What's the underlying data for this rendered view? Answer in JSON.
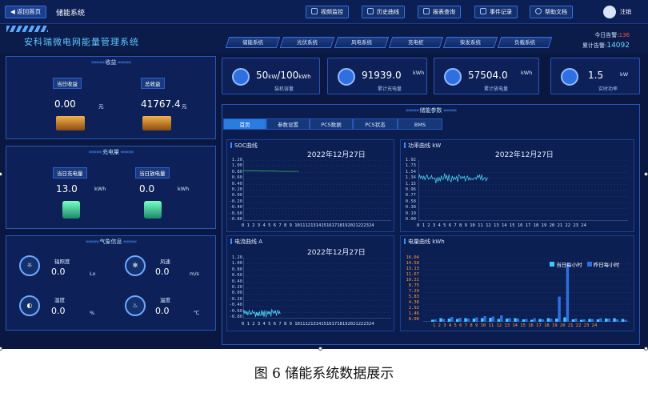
{
  "topbar": {
    "back_label": "返回首页",
    "system_name": "储能系统",
    "buttons": [
      {
        "label": "视频监控",
        "icon": "video-icon"
      },
      {
        "label": "历史曲线",
        "icon": "history-icon"
      },
      {
        "label": "报表查询",
        "icon": "search-icon"
      },
      {
        "label": "事件记录",
        "icon": "document-icon"
      },
      {
        "label": "帮助文档",
        "icon": "help-icon"
      }
    ],
    "logout": "注销"
  },
  "header": {
    "app_title": "安科瑞微电网能量管理系统",
    "tabs": [
      "储能系统",
      "光伏系统",
      "风电系统",
      "充电桩",
      "柴发系统",
      "负载系统"
    ],
    "alarm_today_label": "今日告警:",
    "alarm_today": "136",
    "alarm_total_label": "累计告警:",
    "alarm_total": "14092"
  },
  "revenue": {
    "title": "收益",
    "today_label": "当日收益",
    "today_value": "0.00",
    "today_unit": "元",
    "total_label": "总收益",
    "total_value": "41767.4",
    "total_unit": "元"
  },
  "energy": {
    "title": "充电量",
    "charge_label": "当日充电量",
    "charge_value": "13.0",
    "charge_unit": "kWh",
    "discharge_label": "当日放电量",
    "discharge_value": "0.0",
    "discharge_unit": "kWh"
  },
  "weather": {
    "title": "气象信息",
    "items": [
      {
        "label": "辐照度",
        "value": "0.0",
        "unit": "Lx",
        "icon": "sun-icon"
      },
      {
        "label": "风速",
        "value": "0.0",
        "unit": "m/s",
        "icon": "fan-icon"
      },
      {
        "label": "湿度",
        "value": "0.0",
        "unit": "%",
        "icon": "humidity-icon"
      },
      {
        "label": "温度",
        "value": "0.0",
        "unit": "℃",
        "icon": "thermometer-icon"
      }
    ]
  },
  "cards": [
    {
      "value": "50",
      "unit1": "kW",
      "sep": "/",
      "value2": "100",
      "unit2": "kWh",
      "label": "装机容量",
      "icon": "battery-icon"
    },
    {
      "value": "91939.0",
      "unit": "kWh",
      "label": "累计充电量",
      "icon": "gauge-icon"
    },
    {
      "value": "57504.0",
      "unit": "kWh",
      "label": "累计放电量",
      "icon": "gauge-icon"
    },
    {
      "value": "1.5",
      "unit": "kW",
      "label": "实时功率",
      "icon": "pulse-icon"
    }
  ],
  "params": {
    "title": "储能参数",
    "subtabs": [
      "首页",
      "参数设置",
      "PCS数据",
      "PCS状态",
      "BMS"
    ],
    "active": 0
  },
  "charts": {
    "soc": {
      "title": "SOC曲线",
      "date": "2022年12月27日",
      "yticks": [
        "1.20",
        "1.00",
        "0.80",
        "0.60",
        "0.40",
        "0.20",
        "0.00",
        "-0.20",
        "-0.40",
        "-0.60",
        "-0.80"
      ],
      "xticks": "0 1 2 3 4 5 6 7 8 9 101112131415161718192021222324"
    },
    "power": {
      "title": "功率曲线 kW",
      "date": "2022年12月27日",
      "yticks": [
        "1.92",
        "1.73",
        "1.54",
        "1.34",
        "1.15",
        "0.96",
        "0.77",
        "0.58",
        "0.38",
        "0.19",
        "0.00"
      ],
      "xticks": "0  1  2  3  4  5  6  7  8  9 10 11 12 13 14 15 16 17 18 19 20 21 22 23 24"
    },
    "current": {
      "title": "电流曲线 A",
      "date": "2022年12月27日",
      "yticks": [
        "1.20",
        "1.00",
        "0.80",
        "0.60",
        "0.40",
        "0.20",
        "0.00",
        "-0.20",
        "-0.40",
        "-0.60",
        "-0.80"
      ],
      "xticks": "0 1 2 3 4 5 6 7 8 9 101112131415161718192021222324"
    },
    "electricity": {
      "title": "电量曲线 kWh",
      "yticks": [
        "16.04",
        "14.58",
        "13.13",
        "11.67",
        "10.21",
        "8.75",
        "7.29",
        "5.83",
        "4.38",
        "2.92",
        "1.46",
        "0.00"
      ],
      "xticks": "1  2  3  4  5  6  7  8  9 10 11 12 13 14 15 16 17 18 19 20 21 22 23 24",
      "legend": [
        "当日每小时",
        "昨日每小时"
      ],
      "colors": [
        "#40c8ff",
        "#2f6fe0"
      ]
    }
  },
  "chart_data": [
    {
      "type": "line",
      "title": "SOC曲线",
      "ylim": [
        -0.8,
        1.2
      ],
      "x": [
        0,
        1,
        2,
        3,
        4,
        5,
        6,
        7,
        8,
        9
      ],
      "series": [
        {
          "values": [
            0.85,
            0.85,
            0.85,
            0.84,
            0.84,
            0.84,
            0.83,
            0.83,
            0.83,
            0.83
          ]
        }
      ]
    },
    {
      "type": "line",
      "title": "功率曲线 kW",
      "ylim": [
        0,
        1.92
      ],
      "x": [
        0,
        1,
        2,
        3,
        4,
        5,
        6,
        7,
        8
      ],
      "series": [
        {
          "values": [
            1.34,
            1.38,
            1.3,
            1.4,
            1.33,
            1.36,
            1.31,
            1.39,
            1.35
          ]
        }
      ]
    },
    {
      "type": "line",
      "title": "电流曲线 A",
      "ylim": [
        -0.8,
        1.2
      ],
      "x": [
        0,
        1,
        2,
        3,
        4,
        5,
        6
      ],
      "series": [
        {
          "values": [
            -0.63,
            -0.61,
            -0.64,
            -0.62,
            -0.63,
            -0.6,
            -0.63
          ]
        }
      ]
    },
    {
      "type": "bar",
      "title": "电量曲线 kWh",
      "ylim": [
        0,
        16.04
      ],
      "categories": [
        "1",
        "2",
        "3",
        "4",
        "5",
        "6",
        "7",
        "8",
        "9",
        "10",
        "11",
        "12",
        "13",
        "14",
        "15",
        "16",
        "17",
        "18",
        "19",
        "20",
        "21",
        "22",
        "23",
        "24"
      ],
      "series": [
        {
          "name": "当日每小时",
          "values": [
            0.5,
            0.9,
            0.8,
            0.7,
            0.9,
            0.8,
            0.9,
            1.0,
            0.7,
            0.8,
            0.9,
            0.6,
            0.5,
            0.7,
            0.9,
            0.8,
            1.1,
            0.6,
            0.5,
            0.7,
            0.6,
            0.8,
            0.9,
            0.7
          ]
        },
        {
          "name": "昨日每小时",
          "values": [
            0.6,
            0.7,
            1.2,
            1.0,
            0.8,
            1.1,
            1.4,
            1.3,
            1.6,
            0.9,
            0.8,
            0.7,
            0.9,
            0.6,
            0.8,
            6.3,
            14.6,
            0.8,
            0.6,
            0.7,
            0.9,
            0.8,
            0.6,
            0.5
          ]
        }
      ]
    }
  ],
  "caption": "图 6  储能系统数据展示"
}
